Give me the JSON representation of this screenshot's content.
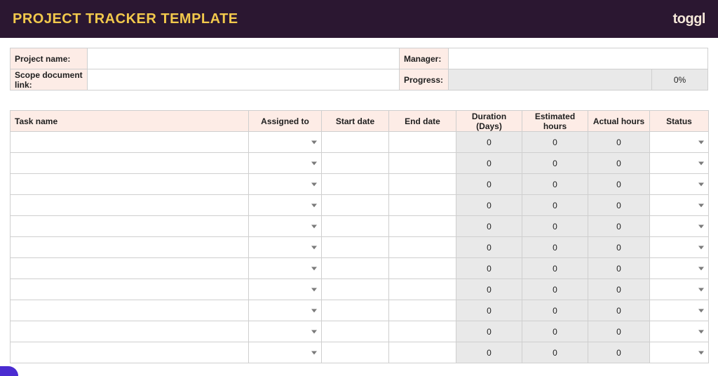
{
  "header": {
    "title": "PROJECT TRACKER TEMPLATE",
    "logo_text": "toggl"
  },
  "meta": {
    "project_name_label": "Project name:",
    "project_name_value": "",
    "manager_label": "Manager:",
    "manager_value": "",
    "scope_label": "Scope document link:",
    "scope_value": "",
    "progress_label": "Progress:",
    "progress_bar_value": "",
    "progress_pct": "0%"
  },
  "columns": {
    "task_name": "Task name",
    "assigned_to": "Assigned to",
    "start_date": "Start date",
    "end_date": "End date",
    "duration": "Duration (Days)",
    "est_hours": "Estimated hours",
    "actual_hours": "Actual hours",
    "status": "Status"
  },
  "rows": [
    {
      "task": "",
      "assigned": "",
      "start": "",
      "end": "",
      "duration": "0",
      "est": "0",
      "actual": "0",
      "status": ""
    },
    {
      "task": "",
      "assigned": "",
      "start": "",
      "end": "",
      "duration": "0",
      "est": "0",
      "actual": "0",
      "status": ""
    },
    {
      "task": "",
      "assigned": "",
      "start": "",
      "end": "",
      "duration": "0",
      "est": "0",
      "actual": "0",
      "status": ""
    },
    {
      "task": "",
      "assigned": "",
      "start": "",
      "end": "",
      "duration": "0",
      "est": "0",
      "actual": "0",
      "status": ""
    },
    {
      "task": "",
      "assigned": "",
      "start": "",
      "end": "",
      "duration": "0",
      "est": "0",
      "actual": "0",
      "status": ""
    },
    {
      "task": "",
      "assigned": "",
      "start": "",
      "end": "",
      "duration": "0",
      "est": "0",
      "actual": "0",
      "status": ""
    },
    {
      "task": "",
      "assigned": "",
      "start": "",
      "end": "",
      "duration": "0",
      "est": "0",
      "actual": "0",
      "status": ""
    },
    {
      "task": "",
      "assigned": "",
      "start": "",
      "end": "",
      "duration": "0",
      "est": "0",
      "actual": "0",
      "status": ""
    },
    {
      "task": "",
      "assigned": "",
      "start": "",
      "end": "",
      "duration": "0",
      "est": "0",
      "actual": "0",
      "status": ""
    },
    {
      "task": "",
      "assigned": "",
      "start": "",
      "end": "",
      "duration": "0",
      "est": "0",
      "actual": "0",
      "status": ""
    },
    {
      "task": "",
      "assigned": "",
      "start": "",
      "end": "",
      "duration": "0",
      "est": "0",
      "actual": "0",
      "status": ""
    }
  ]
}
